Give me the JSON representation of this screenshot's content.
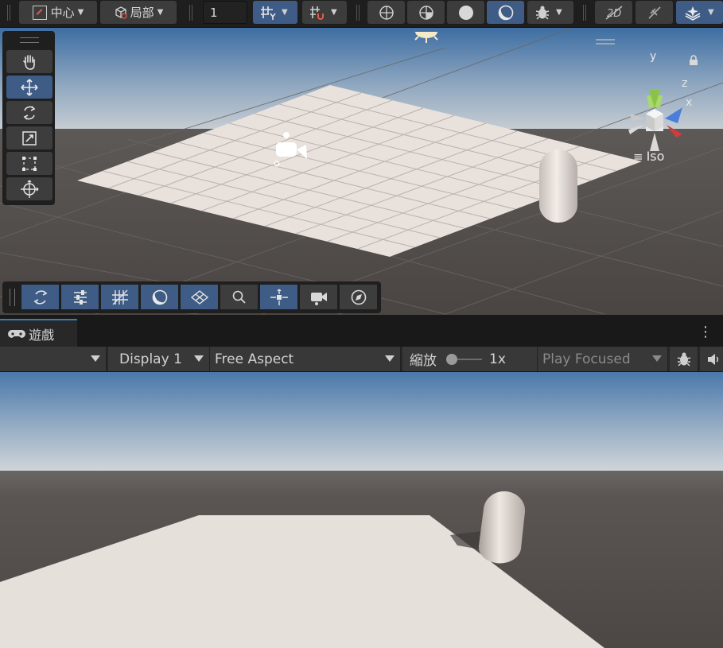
{
  "toolbar": {
    "pivot_label": "中心",
    "space_label": "局部",
    "grid_size_value": "1"
  },
  "scene": {
    "projection_label": "Iso",
    "gizmo_axis_y": "y",
    "gizmo_axis_z": "z",
    "gizmo_axis_x": "x",
    "tools": [
      "hand-tool",
      "move-tool",
      "rotate-tool",
      "scale-tool",
      "rect-tool",
      "transform-tool"
    ],
    "active_tool": "move-tool"
  },
  "game": {
    "tab_label": "遊戲",
    "display_value": "Display 1",
    "aspect_value": "Free Aspect",
    "scale_label": "縮放",
    "scale_value": "1x",
    "play_mode_value": "Play Focused"
  },
  "colors": {
    "accent": "#3e5c86",
    "tab_underline": "#3a79bb",
    "plane": "#e8e1dc",
    "sky_top": "#3d6fa3",
    "ground": "#4a4542"
  }
}
